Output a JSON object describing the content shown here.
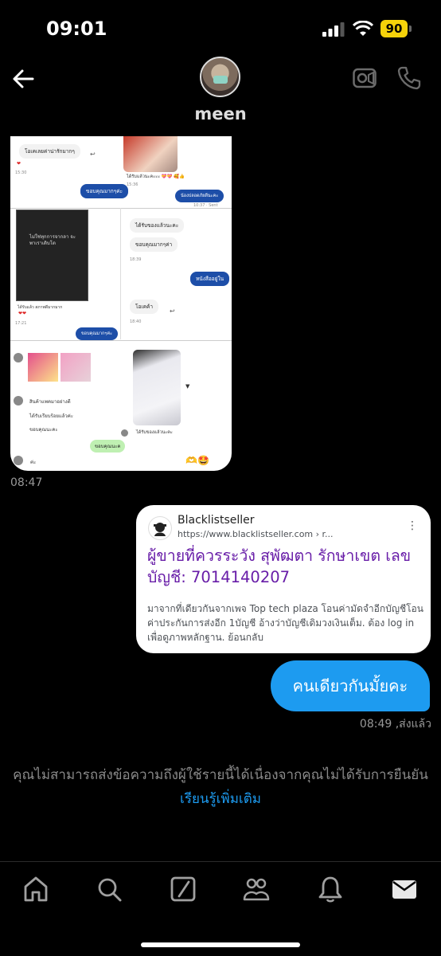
{
  "status_bar": {
    "time": "09:01",
    "battery": "90"
  },
  "header": {
    "contact_name": "meen"
  },
  "chat": {
    "shared_image": {
      "bubbles": [
        "โอเคเลยค่าน่ารักมากๆ",
        "ขอบคุณมากๆค่ะ",
        "ได้รับแล้วนะคะะะ 💝💝 🥰👍",
        "น้องปลอดภัยดีนะคะ",
        "ได้รับของแล้วนะคะ",
        "ขอบคุณมากๆค่า",
        "หนังสืออยู่ใน",
        "ขอบคุณมากๆค่ะ",
        "โอเคค้า",
        "ได้รับแล้ว สภาพดีมากมาก",
        "สินค้าแพคมาอย่างดี",
        "ได้รับเรียบร้อยแล้วค่ะ",
        "ขอบคุณนะคะ",
        "ได้รับของแล้วนะคะ",
        "ขอบคุณนะค",
        "ค่ะ"
      ],
      "book_title": "ไม่ใช่ทุกการจากลา จะพาเราเติบโต",
      "times": [
        "15:30",
        "15:36",
        "18:39",
        "18:40",
        "17:21",
        "10:37 · Sent"
      ]
    },
    "image_time": "08:47",
    "link_card": {
      "site_name": "Blacklistseller",
      "url": "https://www.blacklistseller.com › r...",
      "title": "ผู้ขายที่ควรระวัง สุพัฒตา รักษาเขต เลขบัญชี: 7014140207",
      "snippet": "มาจากที่เดียวกันจากเพจ Top tech plaza โอนค่ามัดจำอีกบัญชีโอนค่าประกันการส่งอีก 1บัญชี อ้างว่าบัญชีเดิมวงเงินเต็ม. ต้อง log in เพื่อดูภาพหลักฐาน. ย้อนกลับ"
    },
    "sent_message": "คนเดียวกันมั้ยคะ",
    "sent_meta": "08:49 ,ส่งแล้ว"
  },
  "notice": {
    "text": "คุณไม่สามารถส่งข้อความถึงผู้ใช้รายนี้ได้เนื่องจากคุณไม่ได้รับการยืนยัน",
    "link": "เรียนรู้เพิ่มเติม"
  },
  "nav": {
    "icons": [
      "home-icon",
      "search-icon",
      "compose-icon",
      "communities-icon",
      "notifications-icon",
      "messages-icon"
    ]
  },
  "colors": {
    "accent": "#1d9bf0",
    "link_title": "#681da8",
    "battery": "#f5d20a"
  }
}
